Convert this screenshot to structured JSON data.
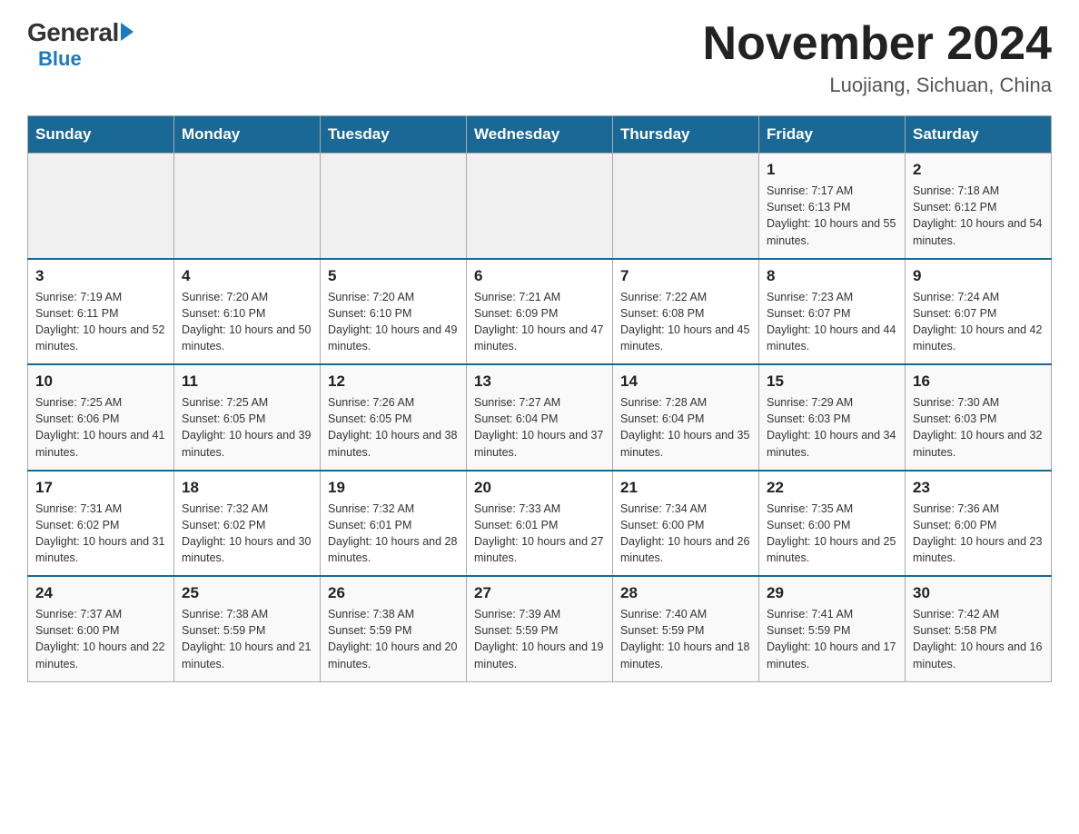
{
  "logo": {
    "general": "General",
    "blue": "Blue"
  },
  "header": {
    "month_year": "November 2024",
    "location": "Luojiang, Sichuan, China"
  },
  "days_of_week": [
    "Sunday",
    "Monday",
    "Tuesday",
    "Wednesday",
    "Thursday",
    "Friday",
    "Saturday"
  ],
  "weeks": [
    {
      "days": [
        {
          "num": "",
          "info": ""
        },
        {
          "num": "",
          "info": ""
        },
        {
          "num": "",
          "info": ""
        },
        {
          "num": "",
          "info": ""
        },
        {
          "num": "",
          "info": ""
        },
        {
          "num": "1",
          "info": "Sunrise: 7:17 AM\nSunset: 6:13 PM\nDaylight: 10 hours and 55 minutes."
        },
        {
          "num": "2",
          "info": "Sunrise: 7:18 AM\nSunset: 6:12 PM\nDaylight: 10 hours and 54 minutes."
        }
      ]
    },
    {
      "days": [
        {
          "num": "3",
          "info": "Sunrise: 7:19 AM\nSunset: 6:11 PM\nDaylight: 10 hours and 52 minutes."
        },
        {
          "num": "4",
          "info": "Sunrise: 7:20 AM\nSunset: 6:10 PM\nDaylight: 10 hours and 50 minutes."
        },
        {
          "num": "5",
          "info": "Sunrise: 7:20 AM\nSunset: 6:10 PM\nDaylight: 10 hours and 49 minutes."
        },
        {
          "num": "6",
          "info": "Sunrise: 7:21 AM\nSunset: 6:09 PM\nDaylight: 10 hours and 47 minutes."
        },
        {
          "num": "7",
          "info": "Sunrise: 7:22 AM\nSunset: 6:08 PM\nDaylight: 10 hours and 45 minutes."
        },
        {
          "num": "8",
          "info": "Sunrise: 7:23 AM\nSunset: 6:07 PM\nDaylight: 10 hours and 44 minutes."
        },
        {
          "num": "9",
          "info": "Sunrise: 7:24 AM\nSunset: 6:07 PM\nDaylight: 10 hours and 42 minutes."
        }
      ]
    },
    {
      "days": [
        {
          "num": "10",
          "info": "Sunrise: 7:25 AM\nSunset: 6:06 PM\nDaylight: 10 hours and 41 minutes."
        },
        {
          "num": "11",
          "info": "Sunrise: 7:25 AM\nSunset: 6:05 PM\nDaylight: 10 hours and 39 minutes."
        },
        {
          "num": "12",
          "info": "Sunrise: 7:26 AM\nSunset: 6:05 PM\nDaylight: 10 hours and 38 minutes."
        },
        {
          "num": "13",
          "info": "Sunrise: 7:27 AM\nSunset: 6:04 PM\nDaylight: 10 hours and 37 minutes."
        },
        {
          "num": "14",
          "info": "Sunrise: 7:28 AM\nSunset: 6:04 PM\nDaylight: 10 hours and 35 minutes."
        },
        {
          "num": "15",
          "info": "Sunrise: 7:29 AM\nSunset: 6:03 PM\nDaylight: 10 hours and 34 minutes."
        },
        {
          "num": "16",
          "info": "Sunrise: 7:30 AM\nSunset: 6:03 PM\nDaylight: 10 hours and 32 minutes."
        }
      ]
    },
    {
      "days": [
        {
          "num": "17",
          "info": "Sunrise: 7:31 AM\nSunset: 6:02 PM\nDaylight: 10 hours and 31 minutes."
        },
        {
          "num": "18",
          "info": "Sunrise: 7:32 AM\nSunset: 6:02 PM\nDaylight: 10 hours and 30 minutes."
        },
        {
          "num": "19",
          "info": "Sunrise: 7:32 AM\nSunset: 6:01 PM\nDaylight: 10 hours and 28 minutes."
        },
        {
          "num": "20",
          "info": "Sunrise: 7:33 AM\nSunset: 6:01 PM\nDaylight: 10 hours and 27 minutes."
        },
        {
          "num": "21",
          "info": "Sunrise: 7:34 AM\nSunset: 6:00 PM\nDaylight: 10 hours and 26 minutes."
        },
        {
          "num": "22",
          "info": "Sunrise: 7:35 AM\nSunset: 6:00 PM\nDaylight: 10 hours and 25 minutes."
        },
        {
          "num": "23",
          "info": "Sunrise: 7:36 AM\nSunset: 6:00 PM\nDaylight: 10 hours and 23 minutes."
        }
      ]
    },
    {
      "days": [
        {
          "num": "24",
          "info": "Sunrise: 7:37 AM\nSunset: 6:00 PM\nDaylight: 10 hours and 22 minutes."
        },
        {
          "num": "25",
          "info": "Sunrise: 7:38 AM\nSunset: 5:59 PM\nDaylight: 10 hours and 21 minutes."
        },
        {
          "num": "26",
          "info": "Sunrise: 7:38 AM\nSunset: 5:59 PM\nDaylight: 10 hours and 20 minutes."
        },
        {
          "num": "27",
          "info": "Sunrise: 7:39 AM\nSunset: 5:59 PM\nDaylight: 10 hours and 19 minutes."
        },
        {
          "num": "28",
          "info": "Sunrise: 7:40 AM\nSunset: 5:59 PM\nDaylight: 10 hours and 18 minutes."
        },
        {
          "num": "29",
          "info": "Sunrise: 7:41 AM\nSunset: 5:59 PM\nDaylight: 10 hours and 17 minutes."
        },
        {
          "num": "30",
          "info": "Sunrise: 7:42 AM\nSunset: 5:58 PM\nDaylight: 10 hours and 16 minutes."
        }
      ]
    }
  ]
}
